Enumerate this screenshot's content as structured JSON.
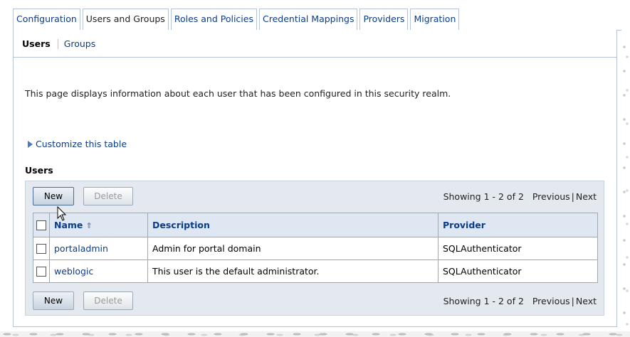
{
  "tabs": [
    {
      "label": "Configuration",
      "active": false
    },
    {
      "label": "Users and Groups",
      "active": true
    },
    {
      "label": "Roles and Policies",
      "active": false
    },
    {
      "label": "Credential Mappings",
      "active": false
    },
    {
      "label": "Providers",
      "active": false
    },
    {
      "label": "Migration",
      "active": false
    }
  ],
  "subnav": {
    "current": "Users",
    "other": "Groups"
  },
  "description": "This page displays information about each user that has been configured in this security realm.",
  "customize_link": "Customize this table",
  "table_title": "Users",
  "toolbar": {
    "new_label": "New",
    "delete_label": "Delete",
    "showing": "Showing 1 - 2 of 2",
    "previous": "Previous",
    "separator": "|",
    "next": "Next"
  },
  "columns": [
    "Name",
    "Description",
    "Provider"
  ],
  "sort_indicator": "⇑",
  "rows": [
    {
      "name": "portaladmin",
      "description": "Admin for portal domain",
      "provider": "SQLAuthenticator"
    },
    {
      "name": "weblogic",
      "description": "This user is the default administrator.",
      "provider": "SQLAuthenticator"
    }
  ],
  "colors": {
    "link": "#0b3c8c",
    "border": "#b5c3d4",
    "header_bg": "#dfe7f3",
    "table_box_bg": "#e4e9f0"
  }
}
